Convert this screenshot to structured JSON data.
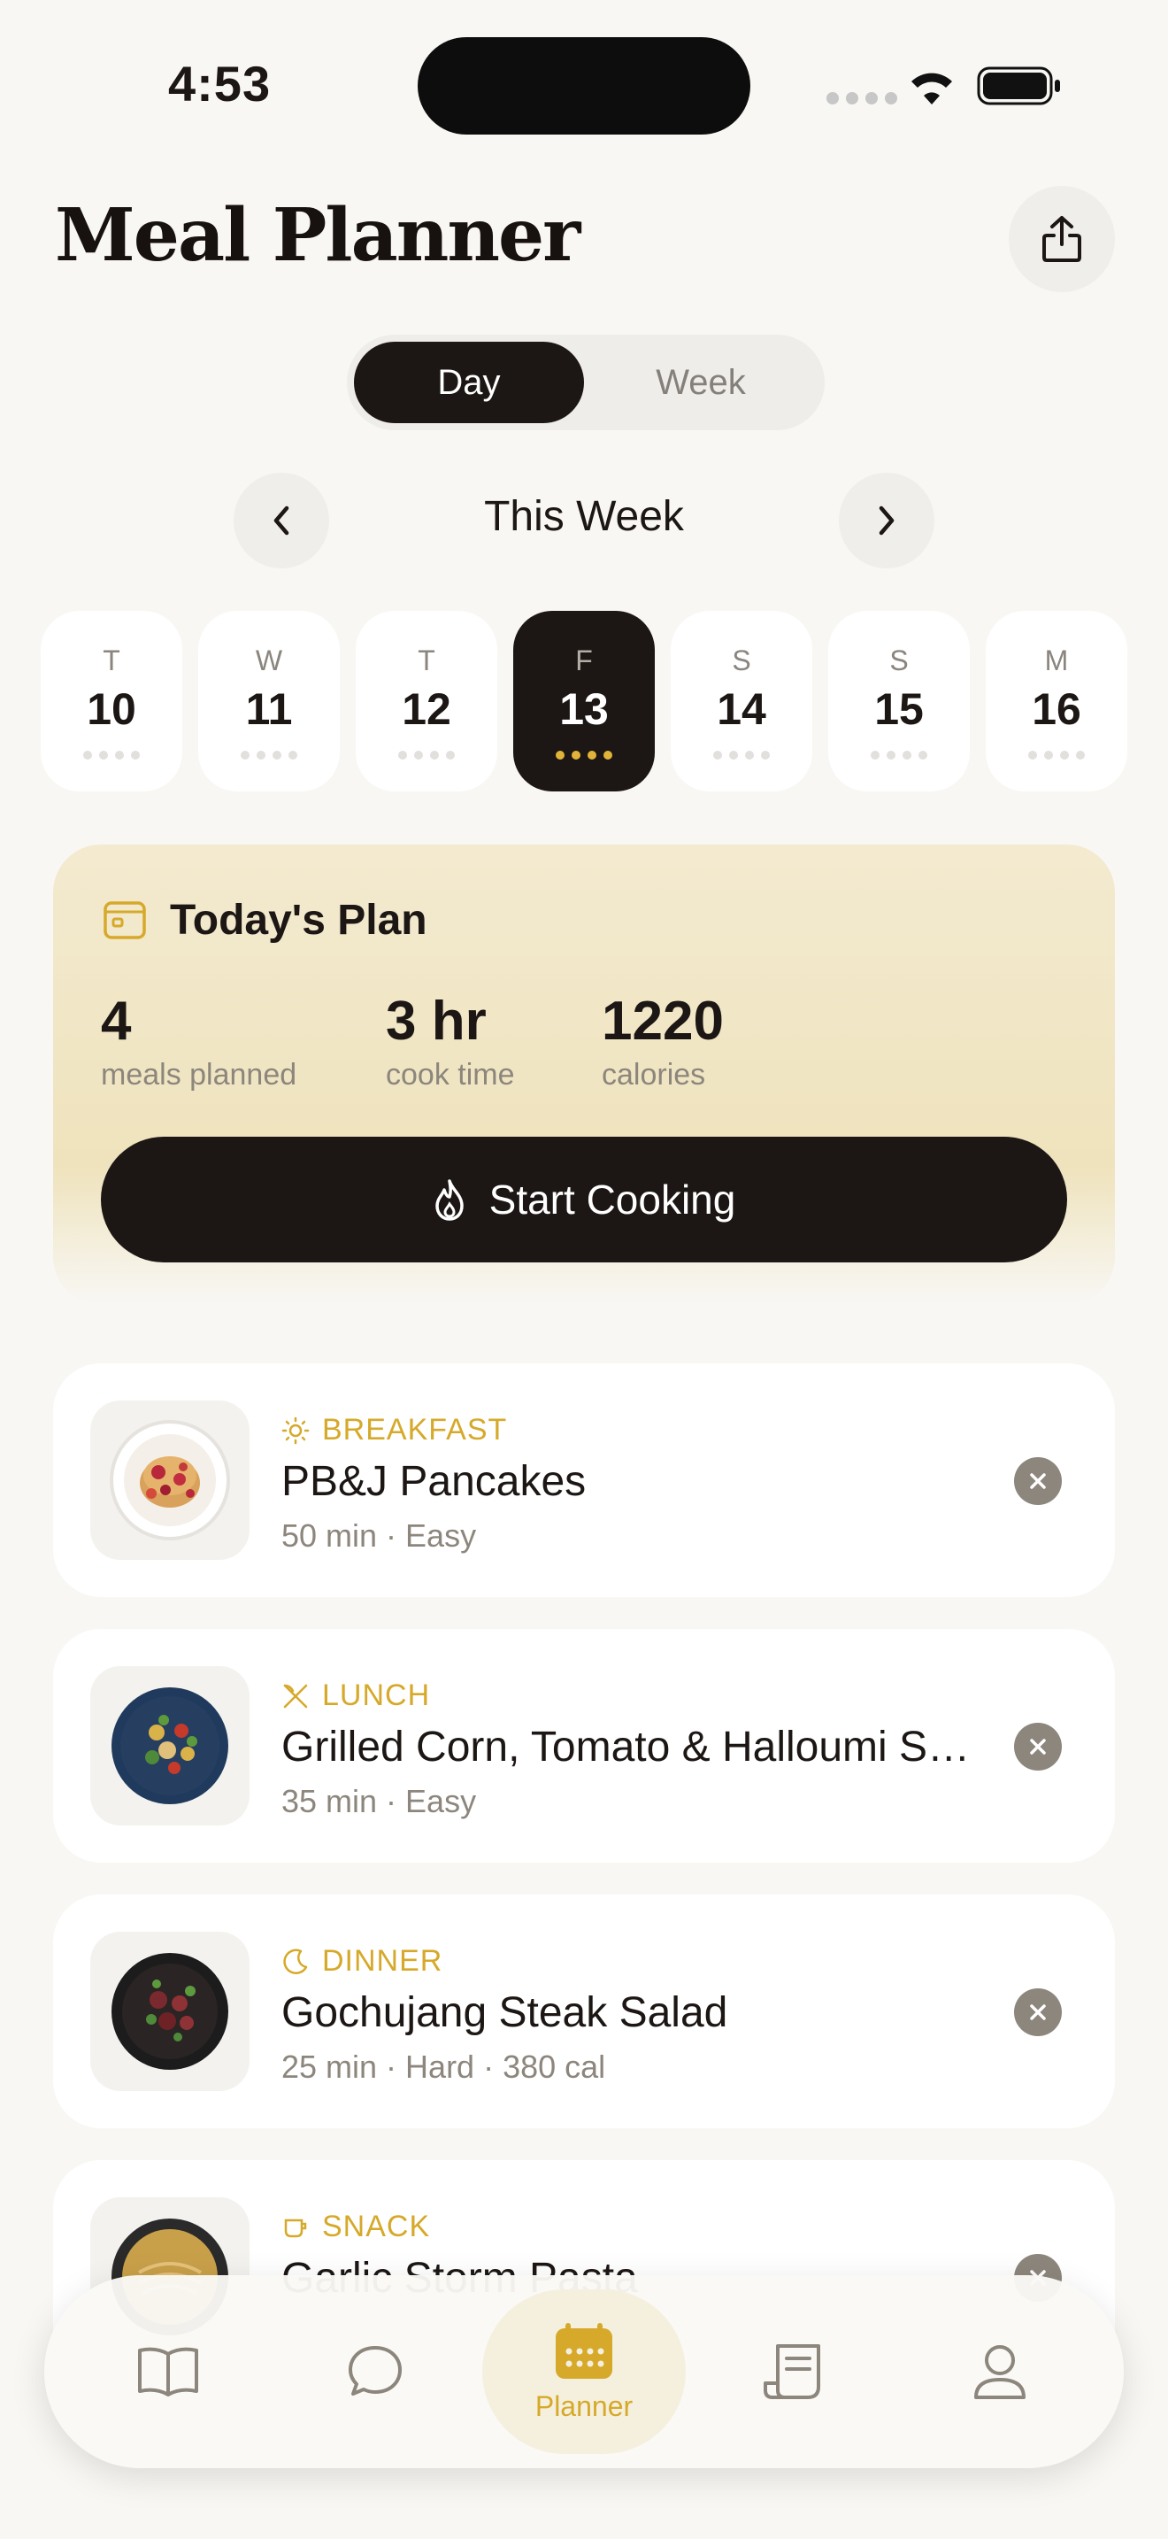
{
  "status_bar": {
    "time": "4:53"
  },
  "header": {
    "title": "Meal Planner",
    "share_icon": "share-icon"
  },
  "view_toggle": {
    "options": [
      "Day",
      "Week"
    ],
    "selected": "Day"
  },
  "week_nav": {
    "label": "This Week"
  },
  "days": [
    {
      "letter": "T",
      "number": "10",
      "selected": false
    },
    {
      "letter": "W",
      "number": "11",
      "selected": false
    },
    {
      "letter": "T",
      "number": "12",
      "selected": false
    },
    {
      "letter": "F",
      "number": "13",
      "selected": true
    },
    {
      "letter": "S",
      "number": "14",
      "selected": false
    },
    {
      "letter": "S",
      "number": "15",
      "selected": false
    },
    {
      "letter": "M",
      "number": "16",
      "selected": false
    }
  ],
  "todays_plan": {
    "title": "Today's Plan",
    "stats": [
      {
        "value": "4",
        "label": "meals planned"
      },
      {
        "value": "3 hr",
        "label": "cook time"
      },
      {
        "value": "1220",
        "label": "calories"
      }
    ],
    "start_button": "Start Cooking"
  },
  "meals": [
    {
      "category": "BREAKFAST",
      "icon": "sun-icon",
      "name": "PB&J Pancakes",
      "meta": "50 min · Easy"
    },
    {
      "category": "LUNCH",
      "icon": "utensils-icon",
      "name": "Grilled Corn, Tomato & Halloumi Salad",
      "meta": "35 min · Easy"
    },
    {
      "category": "DINNER",
      "icon": "moon-icon",
      "name": "Gochujang Steak Salad",
      "meta": "25 min · Hard · 380 cal"
    },
    {
      "category": "SNACK",
      "icon": "cup-icon",
      "name": "Garlic Storm Pasta",
      "meta": ""
    }
  ],
  "tab_bar": {
    "tabs": [
      {
        "icon": "book-icon",
        "label": ""
      },
      {
        "icon": "chat-icon",
        "label": ""
      },
      {
        "icon": "calendar-icon",
        "label": "Planner"
      },
      {
        "icon": "receipt-icon",
        "label": ""
      },
      {
        "icon": "profile-icon",
        "label": ""
      }
    ],
    "active": "Planner"
  },
  "colors": {
    "accent": "#d6a92a",
    "dark": "#1c1714",
    "background": "#f8f7f4"
  }
}
